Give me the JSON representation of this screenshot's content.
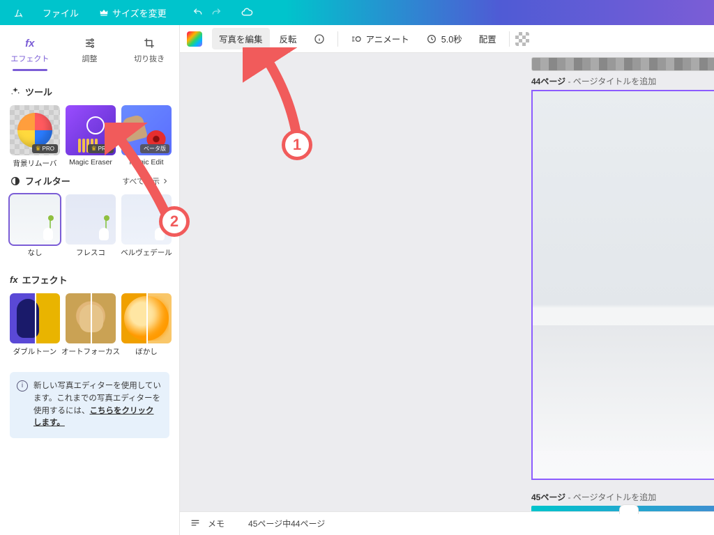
{
  "topbar": {
    "home_fragment": "ム",
    "file": "ファイル",
    "resize": "サイズを変更",
    "icons": {
      "crown": "crown-icon",
      "undo": "undo-icon",
      "redo": "redo-icon",
      "cloud": "cloud-sync-icon"
    }
  },
  "panel_tabs": {
    "effects": "エフェクト",
    "adjust": "調整",
    "crop": "切り抜き"
  },
  "sections": {
    "tools_title": "ツール",
    "filters_title": "フィルター",
    "show_all": "すべて表示",
    "fx_title": "エフェクト"
  },
  "tools": [
    {
      "label": "背景リムーバ",
      "badge": "PRO",
      "badge_kind": "pro"
    },
    {
      "label": "Magic Eraser",
      "badge": "PRO",
      "badge_kind": "pro"
    },
    {
      "label": "Magic Edit",
      "badge": "ベータ版",
      "badge_kind": "beta"
    }
  ],
  "filters": [
    {
      "label": "なし",
      "selected": true
    },
    {
      "label": "フレスコ",
      "selected": false
    },
    {
      "label": "ベルヴェデール",
      "selected": false
    }
  ],
  "fx": [
    {
      "label": "ダブルトーン"
    },
    {
      "label": "オートフォーカス"
    },
    {
      "label": "ぼかし"
    }
  ],
  "notice": {
    "text_a": "新しい写真エディターを使用しています。これまでの写真エディターを使用するには、",
    "link": "こちらをクリックします。"
  },
  "context": {
    "edit_photo": "写真を編集",
    "flip": "反転",
    "animate": "アニメート",
    "duration": "5.0秒",
    "position": "配置"
  },
  "pages": {
    "p44_label": "44ページ",
    "p45_label": "45ページ",
    "title_placeholder": "ページタイトルを追加",
    "sep": " - "
  },
  "bottom": {
    "notes": "メモ",
    "page_counter": "45ページ中44ページ"
  },
  "annotations": {
    "one": "1",
    "two": "2"
  }
}
